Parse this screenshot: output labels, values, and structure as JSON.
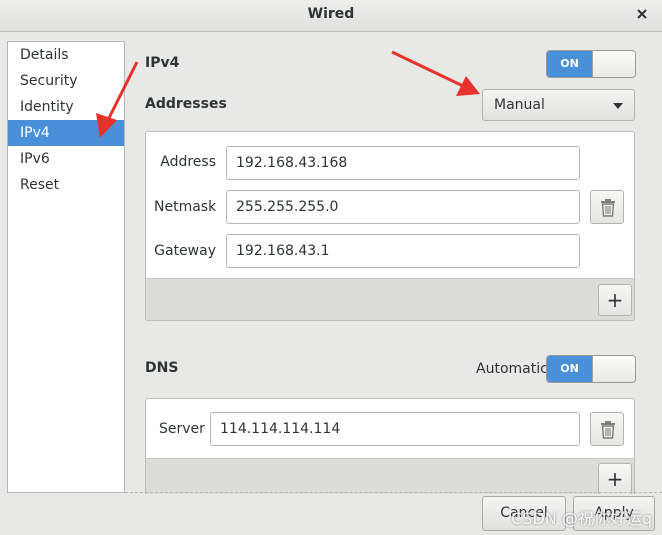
{
  "window": {
    "title": "Wired"
  },
  "sidebar": {
    "items": [
      {
        "label": "Details",
        "selected": false
      },
      {
        "label": "Security",
        "selected": false
      },
      {
        "label": "Identity",
        "selected": false
      },
      {
        "label": "IPv4",
        "selected": true
      },
      {
        "label": "IPv6",
        "selected": false
      },
      {
        "label": "Reset",
        "selected": false
      }
    ]
  },
  "ipv4": {
    "title": "IPv4",
    "toggle_label": "ON",
    "addresses_label": "Addresses",
    "method": "Manual",
    "fields": [
      {
        "label": "Address",
        "value": "192.168.43.168"
      },
      {
        "label": "Netmask",
        "value": "255.255.255.0"
      },
      {
        "label": "Gateway",
        "value": "192.168.43.1"
      }
    ],
    "add_label": "+"
  },
  "dns": {
    "title": "DNS",
    "automatic_label": "Automatic",
    "toggle_label": "ON",
    "server_label": "Server",
    "server_value": "114.114.114.114",
    "add_label": "+"
  },
  "actions": {
    "cancel_label": "Cancel",
    "apply_label": "Apply"
  },
  "watermark": "CSDN @祝你好运q",
  "colors": {
    "accent": "#4a90d9",
    "annotation_arrow": "#e8322c"
  }
}
